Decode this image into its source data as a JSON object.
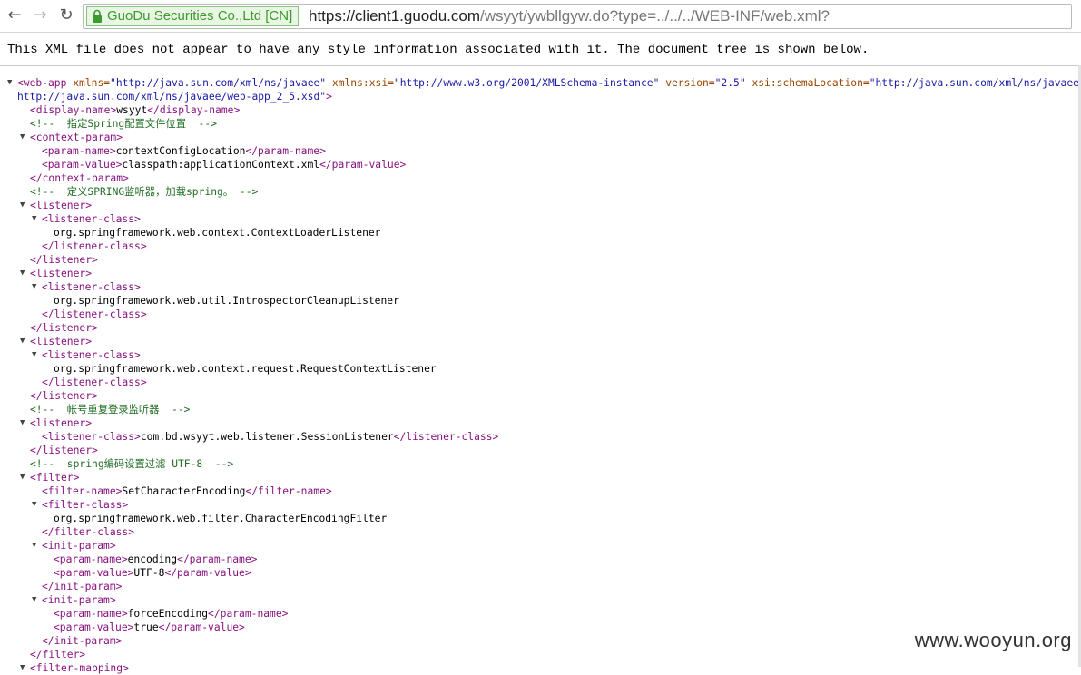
{
  "browser": {
    "back_icon": "←",
    "forward_icon": "→",
    "reload_icon": "↻",
    "ev_label": "GuoDu Securities Co.,Ltd [CN]",
    "url_scheme_host": "https://client1.guodu.com",
    "url_path": "/wsyyt/ywbllgyw.do?type=../../../WEB-INF/web.xml?"
  },
  "info": {
    "text": "This XML file does not appear to have any style information associated with it. The document tree is shown below."
  },
  "xml": {
    "webapp_open": "<web-app",
    "xmlns_attr": "xmlns=",
    "xmlns_val": "\"http://java.sun.com/xml/ns/javaee\"",
    "xsi_attr": "xmlns:xsi=",
    "xsi_val": "\"http://www.w3.org/2001/XMLSchema-instance\"",
    "version_attr": "version=",
    "version_val": "\"2.5\"",
    "schema_attr": "xsi:schemaLocation=",
    "schema_val1": "\"http://java.sun.com/xml/ns/javaee",
    "schema_val2": "http://java.sun.com/xml/ns/javaee/web-app_2_5.xsd\"",
    "gt": ">",
    "display_open": "<display-name>",
    "display_val": "wsyyt",
    "display_close": "</display-name>",
    "c1": "<!--  指定Spring配置文件位置  -->",
    "ctx_open": "<context-param>",
    "ctx_close": "</context-param>",
    "pn_open": "<param-name>",
    "pn_close": "</param-name>",
    "pv_open": "<param-value>",
    "pv_close": "</param-value>",
    "ctx_name": "contextConfigLocation",
    "ctx_value": "classpath:applicationContext.xml",
    "c2": "<!--  定义SPRING监听器，加载spring。 -->",
    "listener_open": "<listener>",
    "listener_close": "</listener>",
    "lc_open": "<listener-class>",
    "lc_close": "</listener-class>",
    "l1": "org.springframework.web.context.ContextLoaderListener",
    "l2": "org.springframework.web.util.IntrospectorCleanupListener",
    "l3": "org.springframework.web.context.request.RequestContextListener",
    "c3": "<!--  帐号重复登录监听器  -->",
    "l4": "com.bd.wsyyt.web.listener.SessionListener",
    "c4": "<!--  spring编码设置过滤 UTF-8  -->",
    "filter_open": "<filter>",
    "filter_close": "</filter>",
    "fn_open": "<filter-name>",
    "fn_close": "</filter-name>",
    "fn_val": "SetCharacterEncoding",
    "fc_open": "<filter-class>",
    "fc_close": "</filter-class>",
    "fc_val": "org.springframework.web.filter.CharacterEncodingFilter",
    "ip_open": "<init-param>",
    "ip_close": "</init-param>",
    "ip1_name": "encoding",
    "ip1_value": "UTF-8",
    "ip2_name": "forceEncoding",
    "ip2_value": "true",
    "fm_open": "<filter-mapping>"
  },
  "watermark": "www.wooyun.org",
  "colors": {
    "tag": "#881280",
    "attr_name": "#994500",
    "attr_value": "#1a1aa6",
    "comment": "#236e25",
    "ev_green": "#3c9a2e"
  }
}
